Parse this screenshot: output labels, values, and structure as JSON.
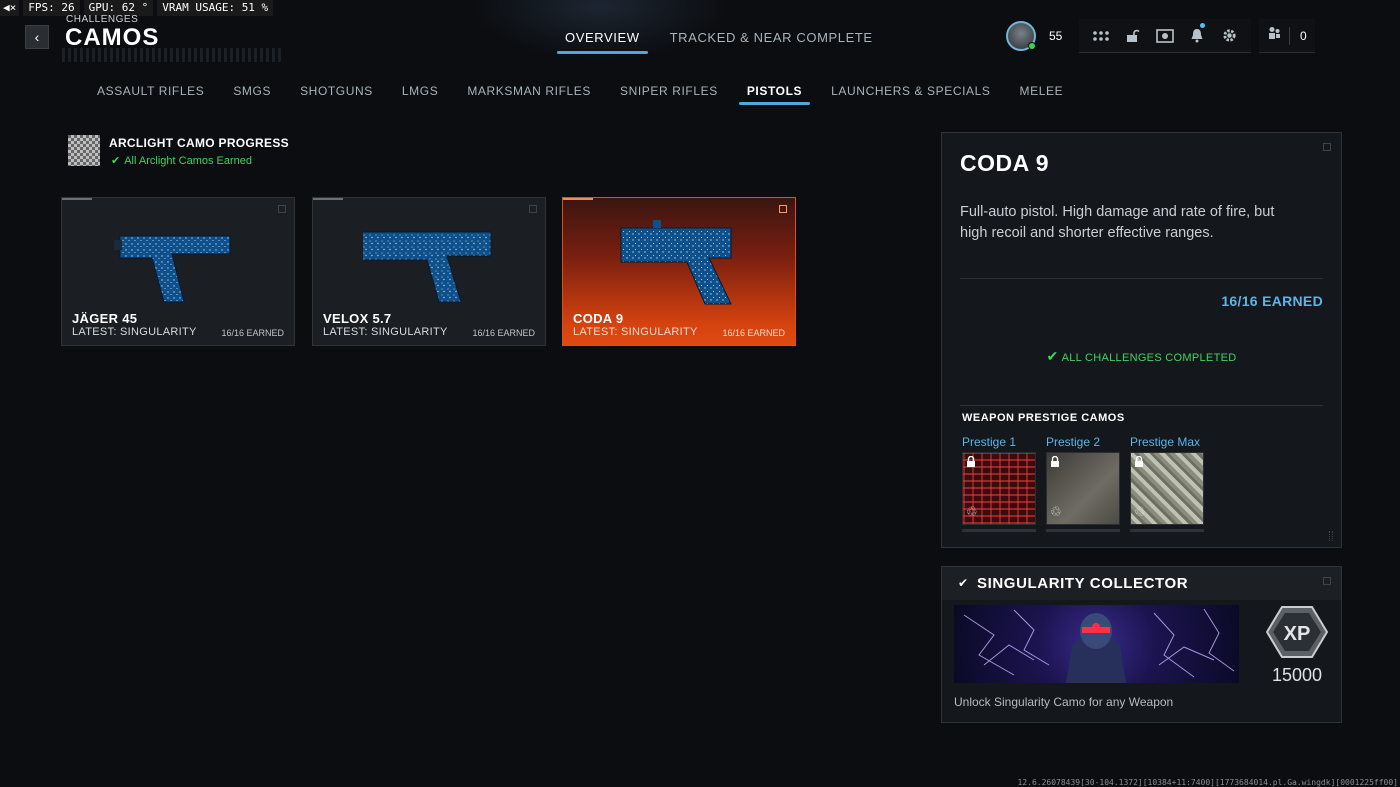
{
  "perf": {
    "fps": "FPS:  26",
    "gpu": "GPU: 62 °",
    "vram": "VRAM USAGE: 51 %"
  },
  "header": {
    "breadcrumb": "CHALLENGES",
    "title": "CAMOS",
    "tabs": [
      {
        "label": "OVERVIEW",
        "active": true
      },
      {
        "label": "TRACKED & NEAR COMPLETE",
        "active": false
      }
    ],
    "player_level": "55",
    "friends_count": "0",
    "icons": [
      "grid-icon",
      "unlock-icon",
      "store-icon",
      "bell-icon",
      "gear-icon",
      "friends-icon"
    ]
  },
  "categories": [
    {
      "label": "ASSAULT RIFLES",
      "active": false
    },
    {
      "label": "SMGS",
      "active": false
    },
    {
      "label": "SHOTGUNS",
      "active": false
    },
    {
      "label": "LMGS",
      "active": false
    },
    {
      "label": "MARKSMAN RIFLES",
      "active": false
    },
    {
      "label": "SNIPER RIFLES",
      "active": false
    },
    {
      "label": "PISTOLS",
      "active": true
    },
    {
      "label": "LAUNCHERS & SPECIALS",
      "active": false
    },
    {
      "label": "MELEE",
      "active": false
    }
  ],
  "arclight": {
    "title": "ARCLIGHT CAMO PROGRESS",
    "status": "All Arclight Camos Earned"
  },
  "weapons": [
    {
      "name": "JÄGER 45",
      "latest": "LATEST: SINGULARITY",
      "earned": "16/16 EARNED",
      "selected": false
    },
    {
      "name": "VELOX 5.7",
      "latest": "LATEST: SINGULARITY",
      "earned": "16/16 EARNED",
      "selected": false
    },
    {
      "name": "CODA 9",
      "latest": "LATEST: SINGULARITY",
      "earned": "16/16 EARNED",
      "selected": true
    }
  ],
  "detail": {
    "name": "CODA 9",
    "description": "Full-auto pistol. High damage and rate of fire, but high recoil and shorter effective ranges.",
    "earned": "16/16 EARNED",
    "complete": "ALL CHALLENGES COMPLETED",
    "prestige_title": "WEAPON PRESTIGE CAMOS",
    "prestige": [
      {
        "label": "Prestige 1",
        "locked": true
      },
      {
        "label": "Prestige 2",
        "locked": true
      },
      {
        "label": "Prestige Max",
        "locked": true
      }
    ]
  },
  "singularity": {
    "title": "SINGULARITY COLLECTOR",
    "xp_label": "XP",
    "xp_amount": "15000",
    "description": "Unlock Singularity Camo for any Weapon"
  },
  "build_string": "12.6.26078439[30-104.1372][10384+11:7400][1773684014.pl.Ga.wingdk][0001225ff00]",
  "colors": {
    "accent": "#4fa8d8",
    "earned_blue": "#5bb6e8",
    "complete_green": "#3cd65b",
    "selected_orange": "#e14a12"
  }
}
